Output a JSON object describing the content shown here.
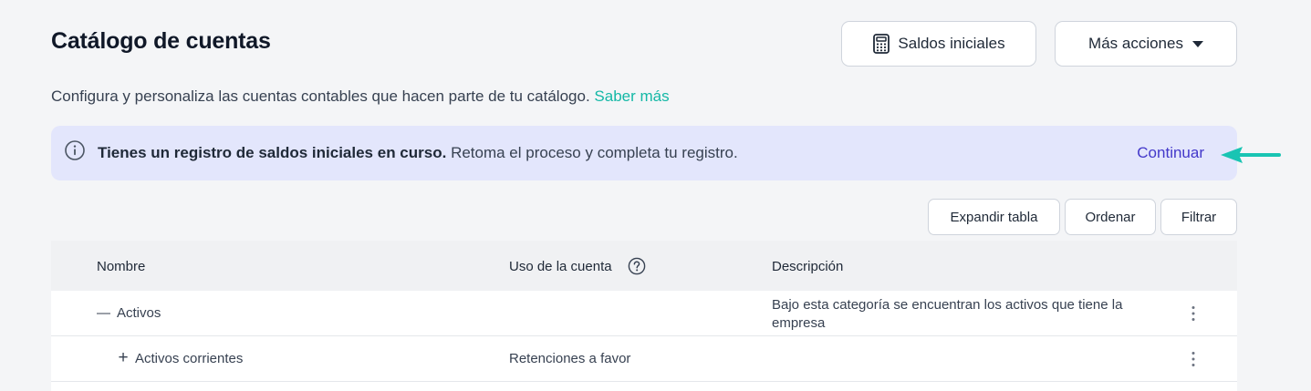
{
  "header": {
    "title": "Catálogo de cuentas",
    "saldos_label": "Saldos iniciales",
    "mas_acciones_label": "Más acciones"
  },
  "subtitle": {
    "text": "Configura y personaliza las cuentas contables que hacen parte de tu catálogo.",
    "link": "Saber más"
  },
  "banner": {
    "bold": "Tienes un registro de saldos iniciales en curso.",
    "rest": "Retoma el proceso y completa tu registro.",
    "action": "Continuar"
  },
  "toolbar": {
    "expandir": "Expandir tabla",
    "ordenar": "Ordenar",
    "filtrar": "Filtrar"
  },
  "table": {
    "columns": [
      "Nombre",
      "Uso de la cuenta",
      "Descripción"
    ],
    "rows": [
      {
        "toggle": "—",
        "name": "Activos",
        "usage": "",
        "description_line1": "Bajo esta categoría se encuentran los activos que tiene la",
        "description_line2": "empresa"
      },
      {
        "toggle": "+",
        "name": "Activos corrientes",
        "usage": "Retenciones a favor",
        "description_line1": "",
        "description_line2": ""
      }
    ]
  },
  "colors": {
    "accent_teal": "#14b8a6",
    "banner_bg": "#e3e6fc",
    "continue_link": "#4338ca",
    "arrow": "#19c4b3"
  },
  "icons": {
    "saldos": "calculator-icon",
    "mas": "caret-down-icon",
    "banner": "info-icon",
    "help": "question-circle-icon",
    "annotation": "arrow-left-icon",
    "row_menu": "kebab-menu-icon"
  }
}
